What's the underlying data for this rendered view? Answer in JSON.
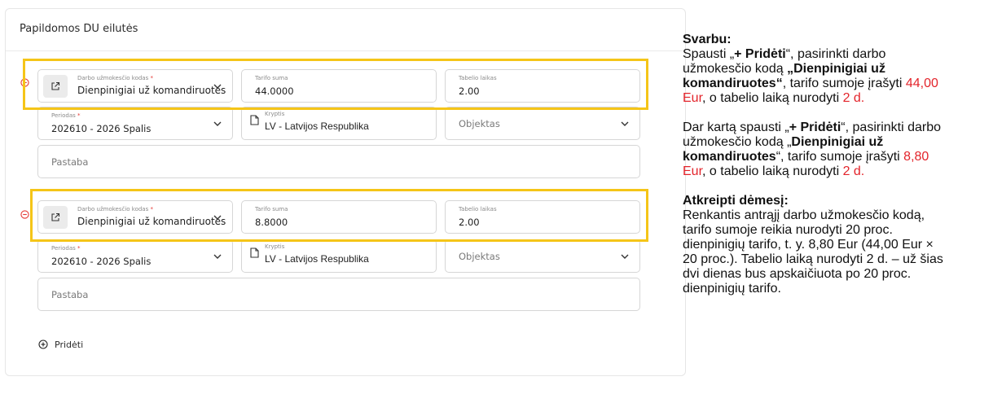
{
  "section": {
    "title": "Papildomos DU eilutės"
  },
  "labels": {
    "code": "Darbo užmokesčio kodas",
    "required_mark": "*",
    "tarifo": "Tarifo suma",
    "tabelio": "Tabelio laikas",
    "periodas": "Periodas",
    "kryptis": "Kryptis",
    "objektas_placeholder": "Objektas",
    "pastaba_placeholder": "Pastaba"
  },
  "rows": [
    {
      "code_value": "Dienpinigiai už komandiruotes",
      "tarifo_value": "44.0000",
      "tabelio_value": "2.00",
      "periodas_value": "202610 - 2026 Spalis",
      "kryptis_value": "LV - Latvijos Respublika"
    },
    {
      "code_value": "Dienpinigiai už komandiruotes",
      "tarifo_value": "8.8000",
      "tabelio_value": "2.00",
      "periodas_value": "202610 - 2026 Spalis",
      "kryptis_value": "LV - Latvijos Respublika"
    }
  ],
  "add_button": {
    "label": "Pridėti"
  },
  "instructions": {
    "p1_head": "Svarbu:",
    "p1_a": "Spausti „",
    "p1_b": "+ Pridėti",
    "p1_c": "“, pasirinkti darbo užmokesčio kodą ",
    "p1_d": "„Dienpinigiai už komandiruotes“",
    "p1_e": ", tarifo sumoje įrašyti ",
    "p1_f": "44,00 Eur",
    "p1_g": ", o tabelio laiką nurodyti ",
    "p1_h": "2 d.",
    "p2_a": "Dar kartą spausti „",
    "p2_b": "+ Pridėti",
    "p2_c": "“, pasirinkti darbo užmokesčio kodą „",
    "p2_d": "Dienpinigiai už komandiruotes",
    "p2_e": "“, tarifo sumoje įrašyti ",
    "p2_f": "8,80 Eur",
    "p2_g": ", o tabelio laiką nurodyti ",
    "p2_h": "2 d.",
    "p3_head": "Atkreipti dėmesį:",
    "p3_text": "Renkantis antrąjį darbo užmokesčio kodą, tarifo sumoje reikia nurodyti 20 proc. dienpinigių tarifo, t. y. 8,80 Eur (44,00 Eur × 20 proc.). Tabelio laiką nurodyti 2 d. – už šias dvi dienas bus apskaičiuota po 20 proc. dienpinigių tarifo."
  },
  "colors": {
    "highlight": "#f5c518",
    "remove_icon": "#e53935",
    "emphasis_red": "#e3242b"
  }
}
